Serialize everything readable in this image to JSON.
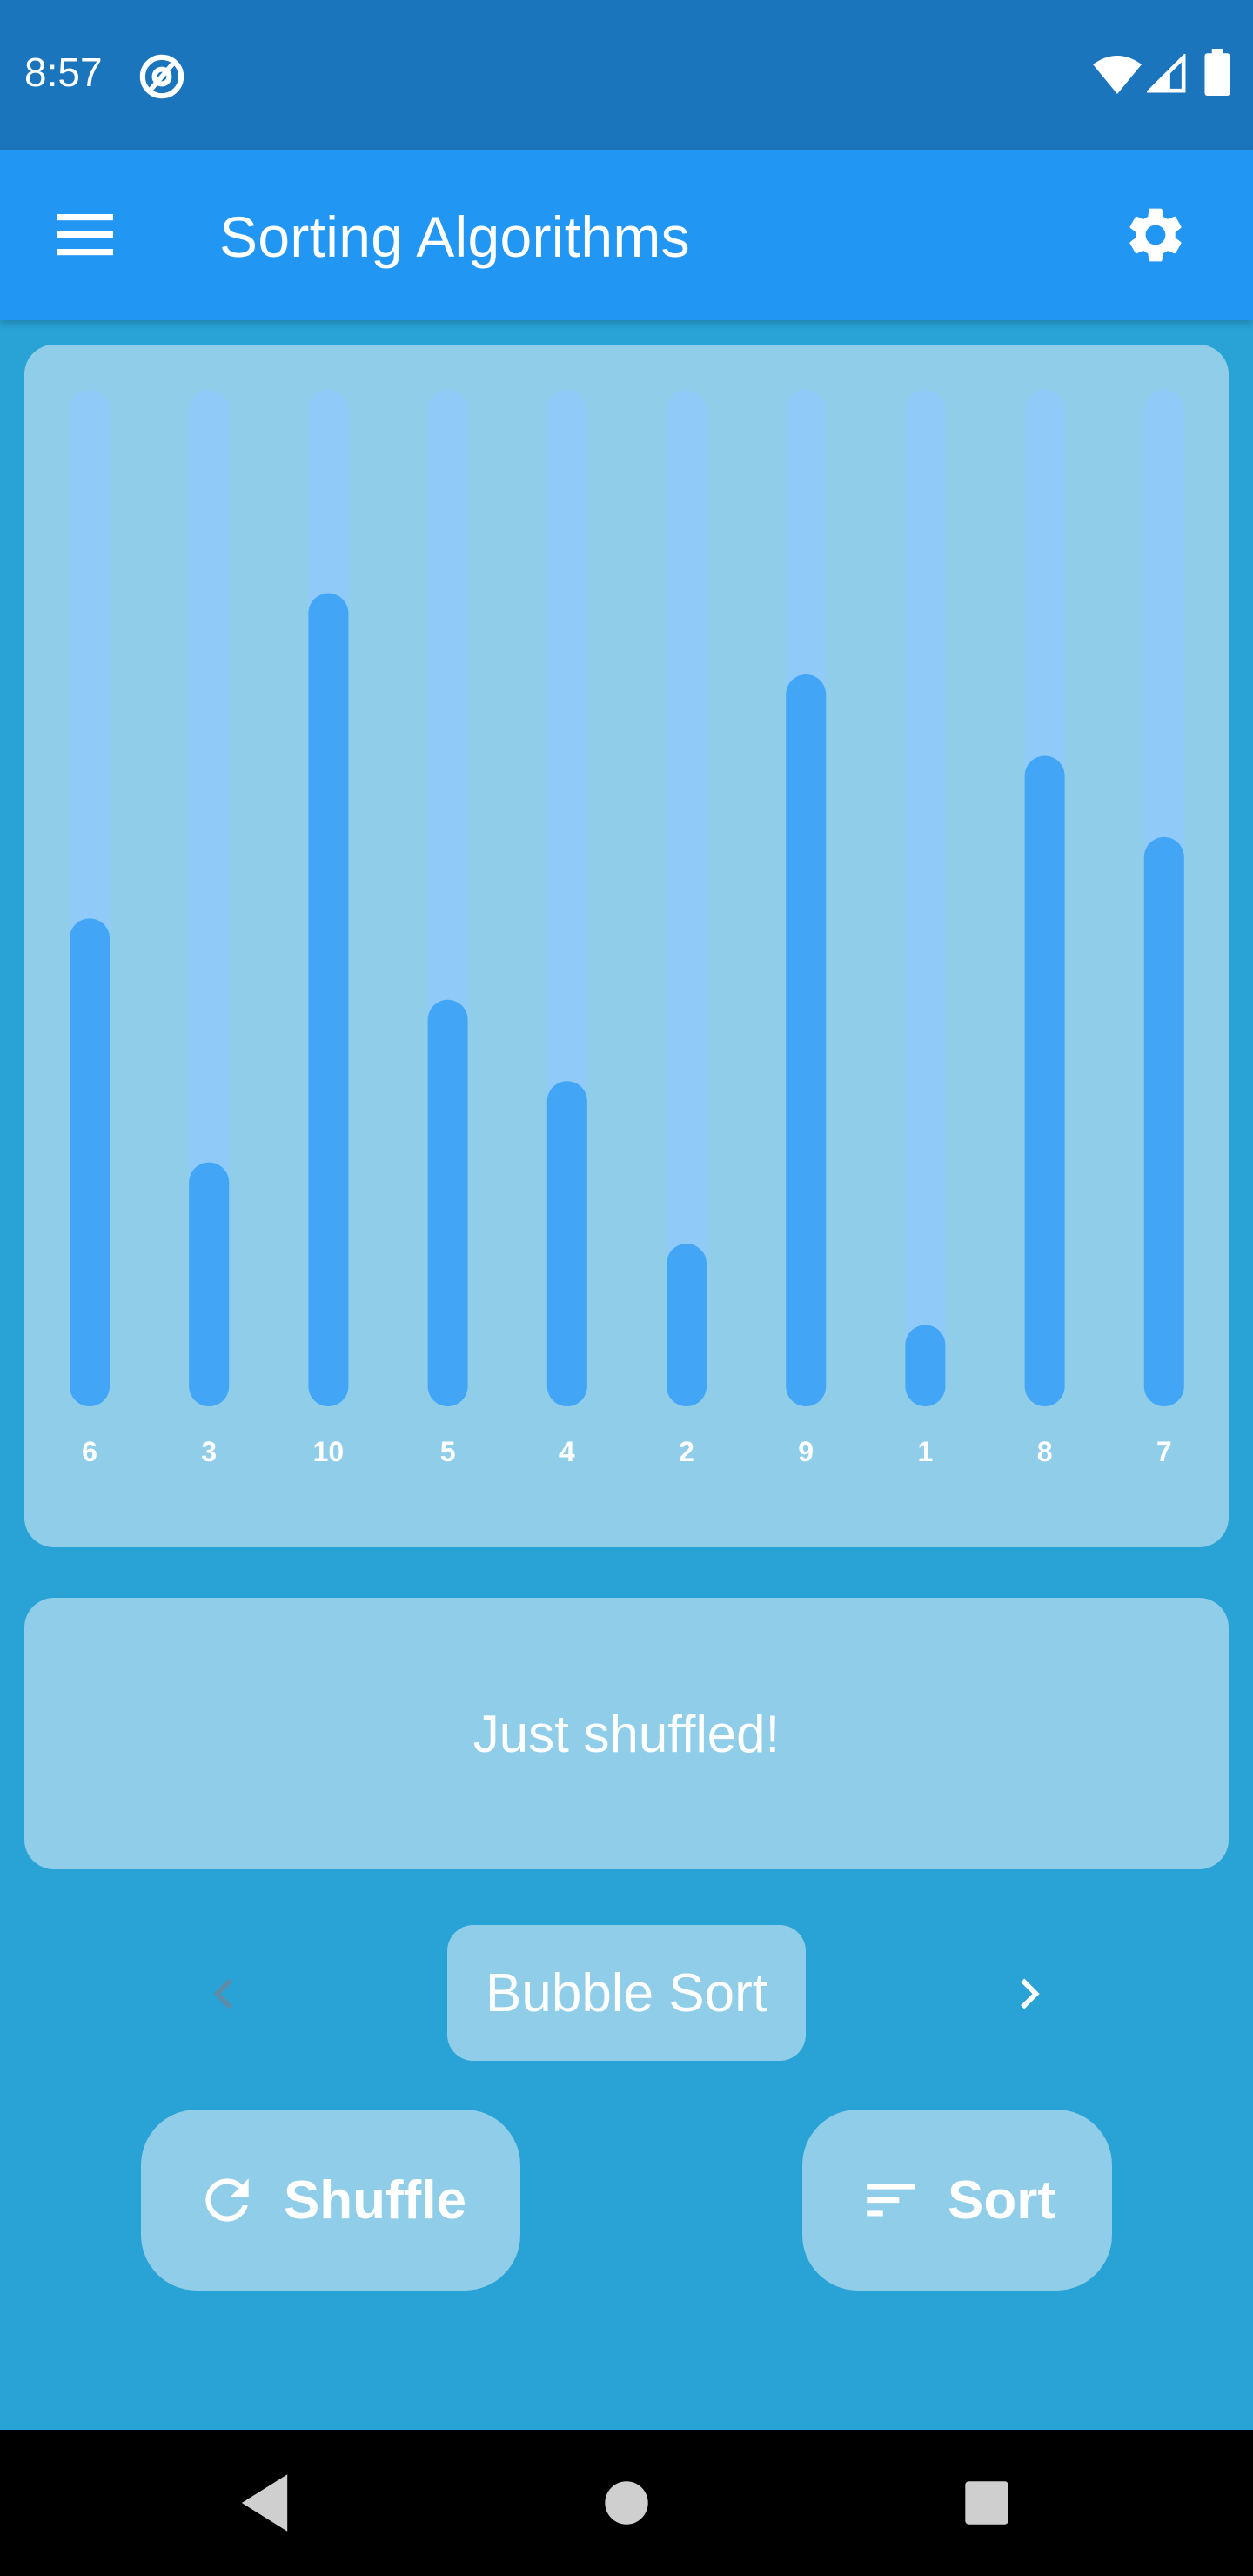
{
  "status_bar": {
    "time": "8:57",
    "icons": [
      "at-sign-icon",
      "wifi-icon",
      "signal-icon",
      "battery-icon"
    ]
  },
  "app_bar": {
    "title": "Sorting Algorithms",
    "menu_icon": "menu-icon",
    "settings_icon": "settings-icon"
  },
  "chart_data": {
    "type": "bar",
    "categories": [
      "6",
      "3",
      "10",
      "5",
      "4",
      "2",
      "9",
      "1",
      "8",
      "7"
    ],
    "values": [
      6,
      3,
      10,
      5,
      4,
      2,
      9,
      1,
      8,
      7
    ],
    "title": "",
    "xlabel": "",
    "ylabel": "",
    "ylim": [
      0,
      12.5
    ],
    "colors": {
      "bar": "#42a5f5",
      "track": "#90caf9",
      "label": "#ffffff"
    }
  },
  "message": {
    "text": "Just shuffled!"
  },
  "algorithm": {
    "label": "Bubble Sort",
    "prev_icon": "chevron-left-icon",
    "next_icon": "chevron-right-icon"
  },
  "actions": {
    "shuffle_label": "Shuffle",
    "shuffle_icon": "refresh-icon",
    "sort_label": "Sort",
    "sort_icon": "sort-icon"
  },
  "colors": {
    "status_bar": "#1b75bc",
    "app_bar": "#2196f3",
    "background": "#29a2d6",
    "card": "#90cde8",
    "disabled_arrow": "#5c8ca8"
  },
  "nav": {
    "icons": [
      "back-icon",
      "home-icon",
      "recents-icon"
    ]
  }
}
